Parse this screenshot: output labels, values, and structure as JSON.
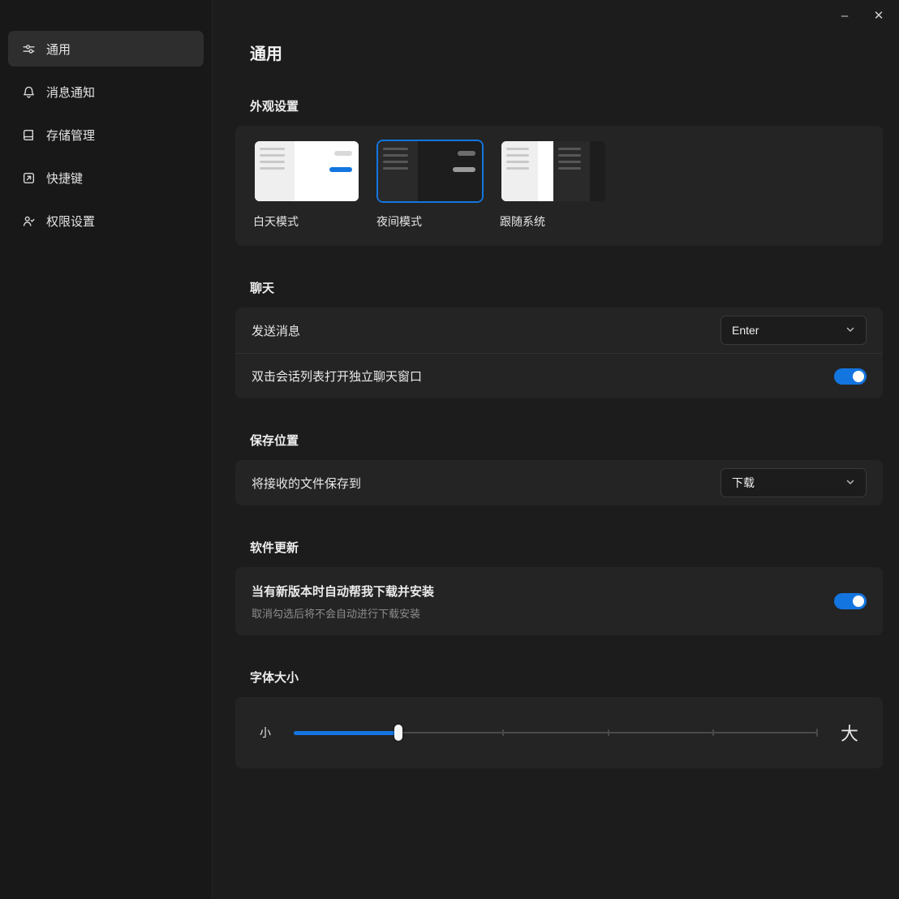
{
  "window": {
    "minimize_label": "–",
    "close_label": "✕"
  },
  "sidebar": {
    "items": [
      {
        "label": "通用",
        "icon": "tune-icon",
        "active": true
      },
      {
        "label": "消息通知",
        "icon": "bell-icon",
        "active": false
      },
      {
        "label": "存储管理",
        "icon": "storage-icon",
        "active": false
      },
      {
        "label": "快捷键",
        "icon": "shortcut-icon",
        "active": false
      },
      {
        "label": "权限设置",
        "icon": "permission-icon",
        "active": false
      }
    ]
  },
  "main": {
    "title": "通用",
    "appearance": {
      "header": "外观设置",
      "options": [
        {
          "label": "白天模式",
          "mode": "light",
          "selected": false
        },
        {
          "label": "夜间模式",
          "mode": "dark",
          "selected": true
        },
        {
          "label": "跟随系统",
          "mode": "auto",
          "selected": false
        }
      ]
    },
    "chat": {
      "header": "聊天",
      "send_message_label": "发送消息",
      "send_message_value": "Enter",
      "double_click_label": "双击会话列表打开独立聊天窗口",
      "double_click_enabled": true
    },
    "save_location": {
      "header": "保存位置",
      "label": "将接收的文件保存到",
      "value": "下载"
    },
    "software_update": {
      "header": "软件更新",
      "label": "当有新版本时自动帮我下载并安装",
      "description": "取消勾选后将不会自动进行下载安装",
      "enabled": true
    },
    "font_size": {
      "header": "字体大小",
      "min_label": "小",
      "max_label": "大",
      "value_percent": 20
    }
  },
  "colors": {
    "accent": "#1375e0"
  }
}
